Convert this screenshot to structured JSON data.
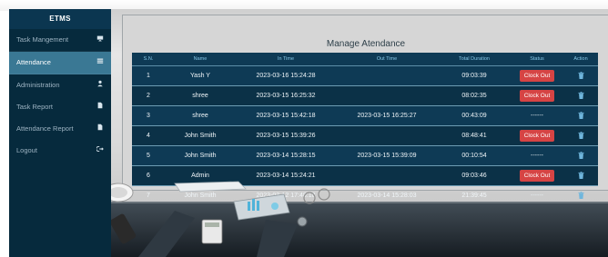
{
  "sidebar": {
    "brand": "ETMS",
    "items": [
      {
        "label": "Task Mangement",
        "icon": "monitor-icon",
        "active": false
      },
      {
        "label": "Attendance",
        "icon": "list-icon",
        "active": true
      },
      {
        "label": "Administration",
        "icon": "user-icon",
        "active": false
      },
      {
        "label": "Task Report",
        "icon": "file-icon",
        "active": false
      },
      {
        "label": "Attendance Report",
        "icon": "file-icon",
        "active": false
      },
      {
        "label": "Logout",
        "icon": "logout-icon",
        "active": false
      }
    ]
  },
  "main": {
    "title": "Manage Atendance",
    "columns": [
      "S.N.",
      "Name",
      "In Time",
      "Out Time",
      "Total Duration",
      "Status",
      "Action"
    ],
    "rows": [
      {
        "sn": "1",
        "name": "Yash Y",
        "in_time": "2023-03-16 15:24:28",
        "out_time": "",
        "duration": "09:03:39",
        "status": "Clock Out"
      },
      {
        "sn": "2",
        "name": "shree",
        "in_time": "2023-03-15 16:25:32",
        "out_time": "",
        "duration": "08:02:35",
        "status": "Clock Out"
      },
      {
        "sn": "3",
        "name": "shree",
        "in_time": "2023-03-15 15:42:18",
        "out_time": "2023-03-15 16:25:27",
        "duration": "00:43:09",
        "status": "------"
      },
      {
        "sn": "4",
        "name": "John Smith",
        "in_time": "2023-03-15 15:39:26",
        "out_time": "",
        "duration": "08:48:41",
        "status": "Clock Out"
      },
      {
        "sn": "5",
        "name": "John Smith",
        "in_time": "2023-03-14 15:28:15",
        "out_time": "2023-03-15 15:39:09",
        "duration": "00:10:54",
        "status": "------"
      },
      {
        "sn": "6",
        "name": "Admin",
        "in_time": "2023-03-14 15:24:21",
        "out_time": "",
        "duration": "09:03:46",
        "status": "Clock Out"
      },
      {
        "sn": "7",
        "name": "John Smith",
        "in_time": "2023-03-12 17:48:18",
        "out_time": "2023-03-14 15:28:03",
        "duration": "21:39:45",
        "status": "------"
      }
    ],
    "action_icon": "trash-icon",
    "colors": {
      "sidebar_bg": "#062a3d",
      "active_item": "#3a7894",
      "table_bg": "#0e3a55",
      "header_text": "#86c8e8",
      "clock_out_button": "#d64444"
    }
  }
}
